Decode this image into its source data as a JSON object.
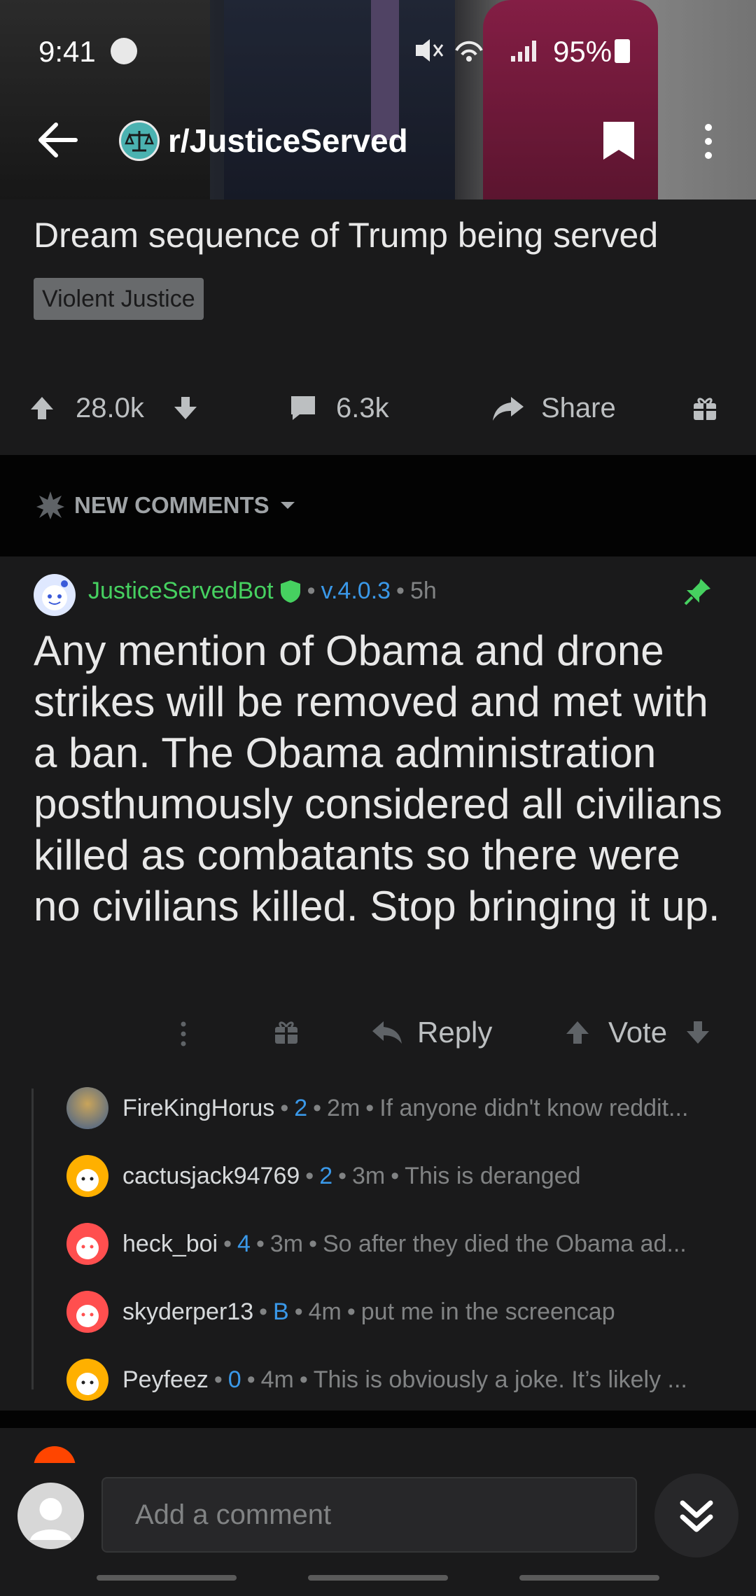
{
  "status_bar": {
    "time": "9:41",
    "battery": "95%"
  },
  "nav": {
    "subreddit": "r/JusticeServed"
  },
  "post": {
    "title": "Dream sequence of Trump being served",
    "flair": "Violent Justice",
    "upvotes": "28.0k",
    "comments": "6.3k",
    "share_label": "Share"
  },
  "sort": {
    "label": "NEW COMMENTS"
  },
  "pinned_comment": {
    "author": "JusticeServedBot",
    "version": "v.4.0.3",
    "age": "5h",
    "body": "Any mention of Obama and drone strikes will be removed and met with a ban. The Obama administration posthumously considered all civilians killed as combatants so there were no civilians killed. Stop bringing it up.",
    "reply_label": "Reply",
    "vote_label": "Vote"
  },
  "replies": [
    {
      "user": "FireKingHorus",
      "score": "2",
      "time": "2m",
      "text": "If anyone didn't know reddit..."
    },
    {
      "user": "cactusjack94769",
      "score": "2",
      "time": "3m",
      "text": "This is deranged"
    },
    {
      "user": "heck_boi",
      "score": "4",
      "time": "3m",
      "text": "So after they died the Obama ad..."
    },
    {
      "user": "skyderper13",
      "score": "B",
      "time": "4m",
      "text": "put me in the screencap"
    },
    {
      "user": "Peyfeez",
      "score": "0",
      "time": "4m",
      "text": "This is obviously a joke. It’s likely ..."
    }
  ],
  "composer": {
    "placeholder": "Add a comment"
  },
  "colors": {
    "mod_green": "#46d160",
    "link_blue": "#3a98e8",
    "background": "#1a1a1b"
  }
}
